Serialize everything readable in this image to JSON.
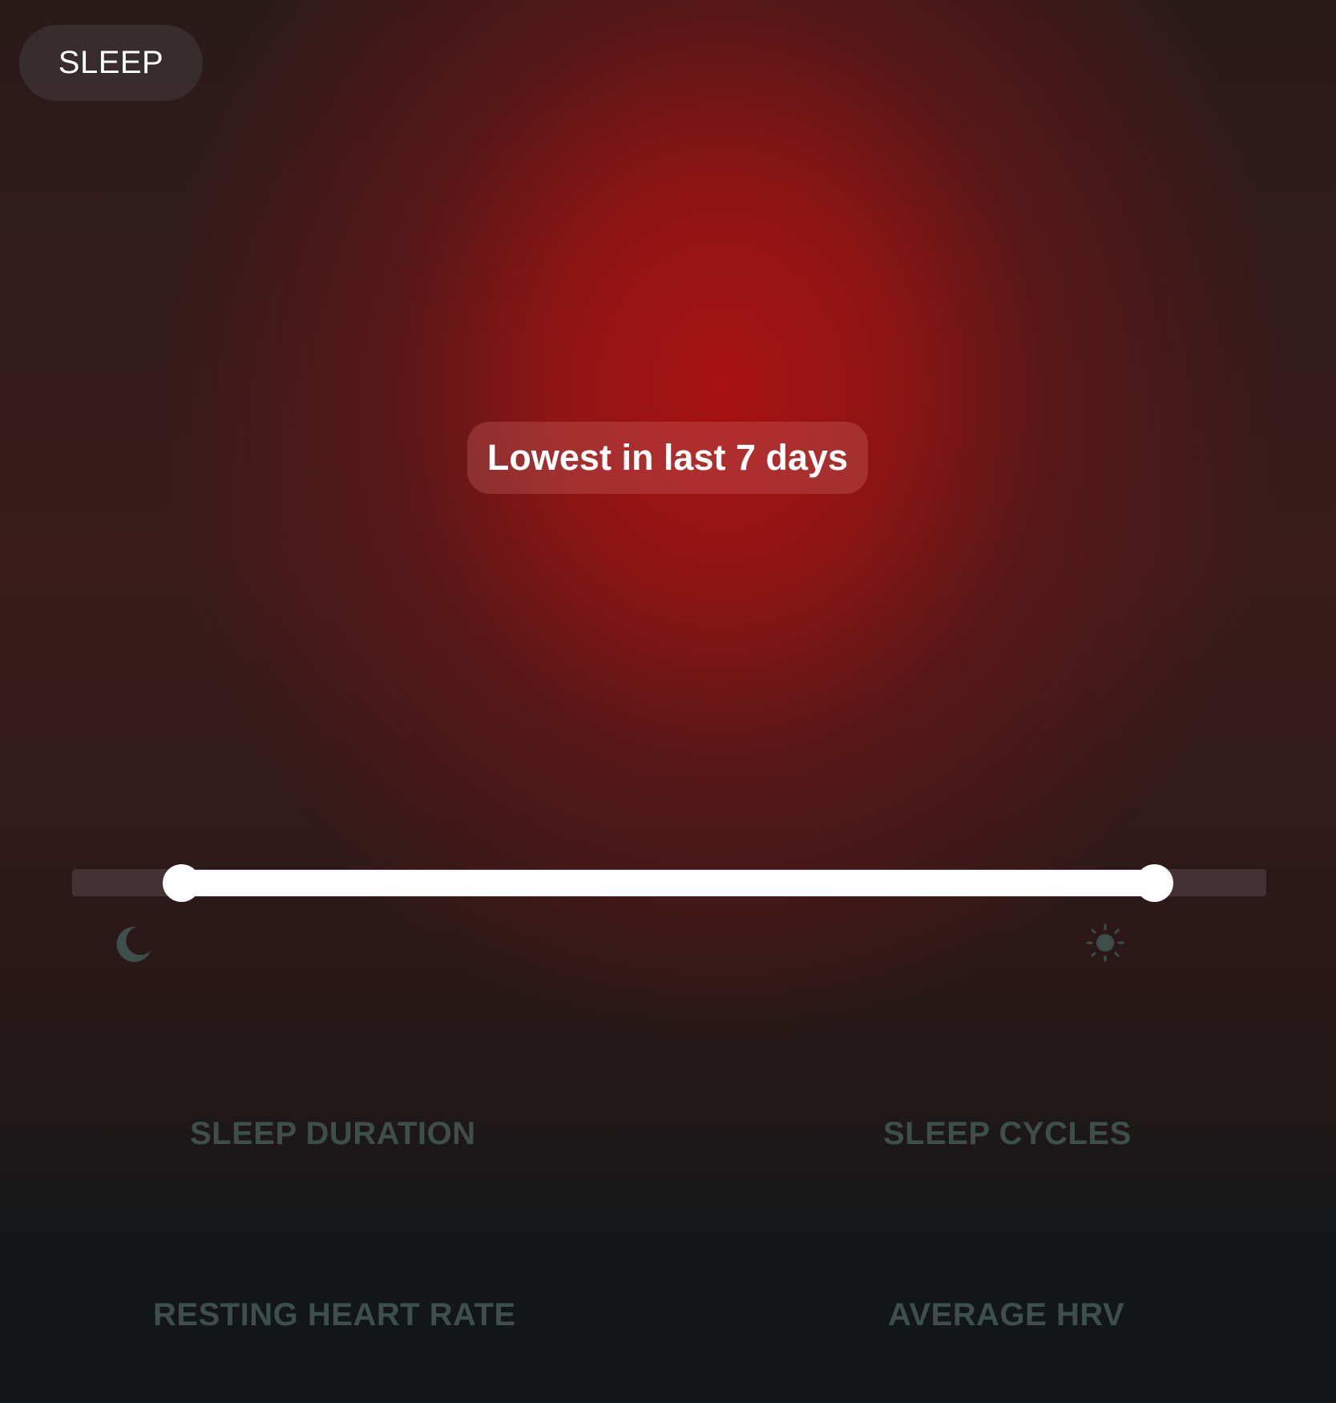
{
  "header": {
    "section_label": "SLEEP"
  },
  "highlight": {
    "label": "Lowest in last 7 days"
  },
  "slider": {
    "start_icon": "moon-icon",
    "end_icon": "sun-icon",
    "range_start_fraction": 0.08,
    "range_end_fraction": 0.9
  },
  "metrics": {
    "sleep_duration": "SLEEP DURATION",
    "sleep_cycles": "SLEEP CYCLES",
    "resting_heart_rate": "RESTING HEART RATE",
    "average_hrv": "AVERAGE HRV"
  },
  "colors": {
    "accent": "#a81212",
    "metric_label": "#3e4f4b",
    "background": "#121617"
  }
}
